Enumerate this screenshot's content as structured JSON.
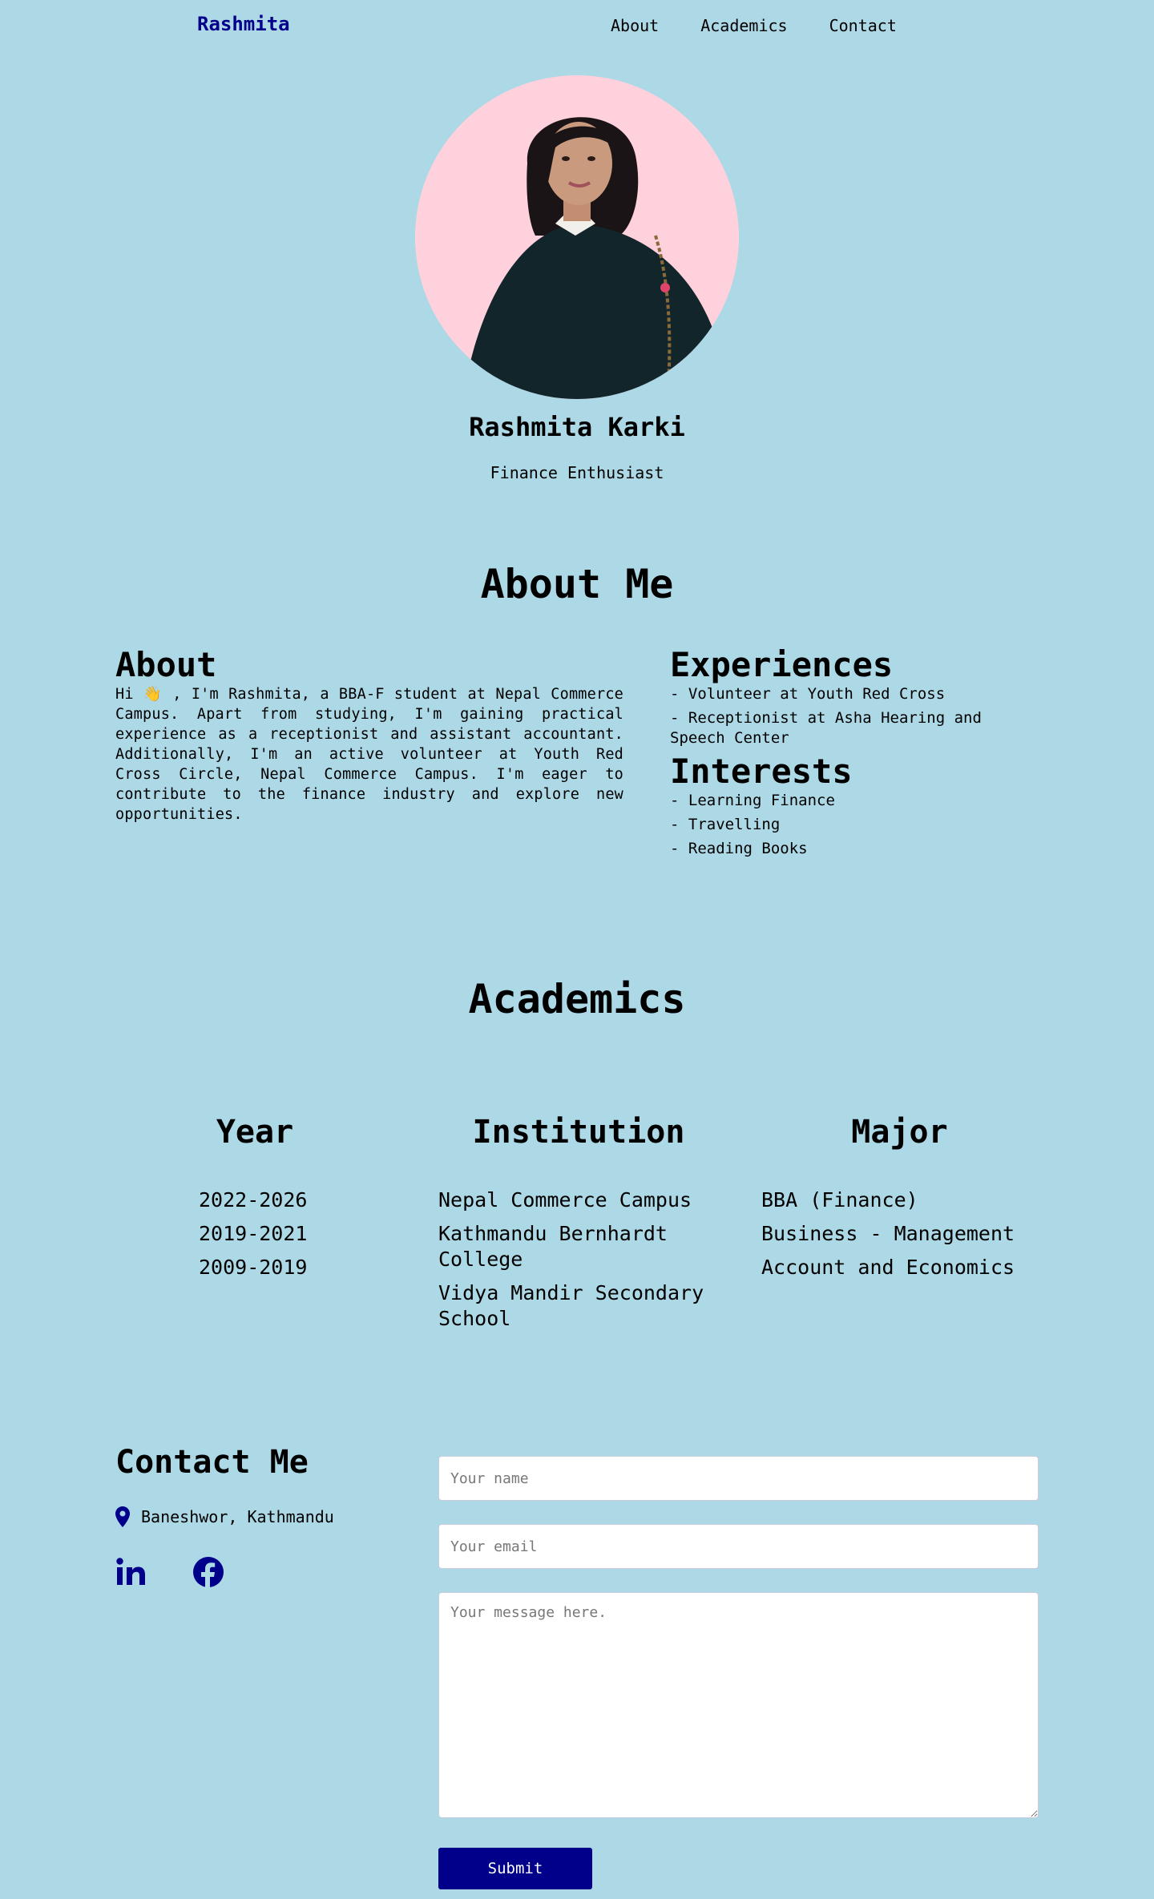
{
  "nav": {
    "brand": "Rashmita",
    "links": [
      "About",
      "Academics",
      "Contact"
    ]
  },
  "hero": {
    "name": "Rashmita Karki",
    "role": "Finance Enthusiast"
  },
  "about_section": {
    "title": "About Me",
    "about_heading": "About",
    "about_text": "Hi 👋 , I'm Rashmita, a BBA-F student at Nepal Commerce Campus. Apart from studying, I'm gaining practical experience as a receptionist and assistant accountant. Additionally, I'm an active volunteer at Youth Red Cross Circle, Nepal Commerce Campus. I'm eager to contribute to the finance industry and explore new opportunities.",
    "experiences_heading": "Experiences",
    "experiences": [
      "Volunteer at Youth Red Cross",
      "Receptionist at Asha Hearing and Speech Center"
    ],
    "interests_heading": "Interests",
    "interests": [
      "Learning Finance",
      "Travelling",
      "Reading Books"
    ]
  },
  "academics": {
    "title": "Academics",
    "year_heading": "Year",
    "institution_heading": "Institution",
    "major_heading": "Major",
    "years": [
      "2022-2026",
      "2019-2021",
      "2009-2019"
    ],
    "institutions": [
      "Nepal Commerce Campus",
      "Kathmandu Bernhardt College",
      "Vidya Mandir Secondary School"
    ],
    "majors": [
      "BBA (Finance)",
      "Business - Management",
      "Account and Economics"
    ]
  },
  "contact": {
    "title": "Contact Me",
    "location": "Baneshwor, Kathmandu",
    "name_placeholder": "Your name",
    "email_placeholder": "Your email",
    "message_placeholder": "Your message here.",
    "submit_label": "Submit",
    "icons": [
      "location-pin-icon",
      "linkedin-icon",
      "facebook-icon"
    ]
  },
  "colors": {
    "background": "#add8e6",
    "brand": "#00008b",
    "avatar_bg": "#ffd1dc",
    "button": "#00008b"
  }
}
